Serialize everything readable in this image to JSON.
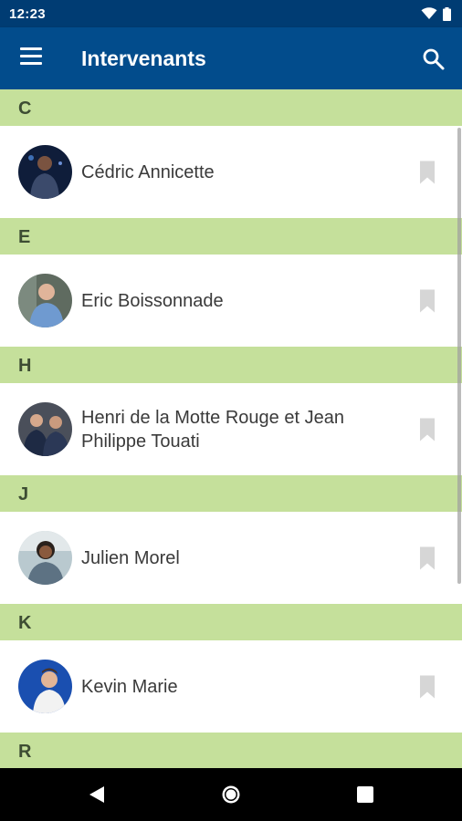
{
  "status_bar": {
    "time": "12:23",
    "icons": [
      "wifi-icon",
      "battery-icon"
    ]
  },
  "app_bar": {
    "title": "Intervenants",
    "menu_icon": "hamburger-menu-icon",
    "search_icon": "search-icon"
  },
  "colors": {
    "status_bar": "#003c73",
    "app_bar": "#024c8c",
    "section_header": "#c5e09b",
    "section_text": "#3d4d33",
    "name_text": "#3a3a3a",
    "bookmark": "#d6d6d6"
  },
  "sections": [
    {
      "letter": "C",
      "people": [
        {
          "name": "Cédric Annicette"
        }
      ]
    },
    {
      "letter": "E",
      "people": [
        {
          "name": "Eric Boissonnade"
        }
      ]
    },
    {
      "letter": "H",
      "people": [
        {
          "name": "Henri de la Motte Rouge et Jean Philippe Touati"
        }
      ]
    },
    {
      "letter": "J",
      "people": [
        {
          "name": "Julien Morel"
        }
      ]
    },
    {
      "letter": "K",
      "people": [
        {
          "name": "Kevin Marie"
        }
      ]
    },
    {
      "letter": "R",
      "people": []
    }
  ],
  "nav_bar": {
    "buttons": [
      "back-icon",
      "home-icon",
      "recents-icon"
    ]
  }
}
